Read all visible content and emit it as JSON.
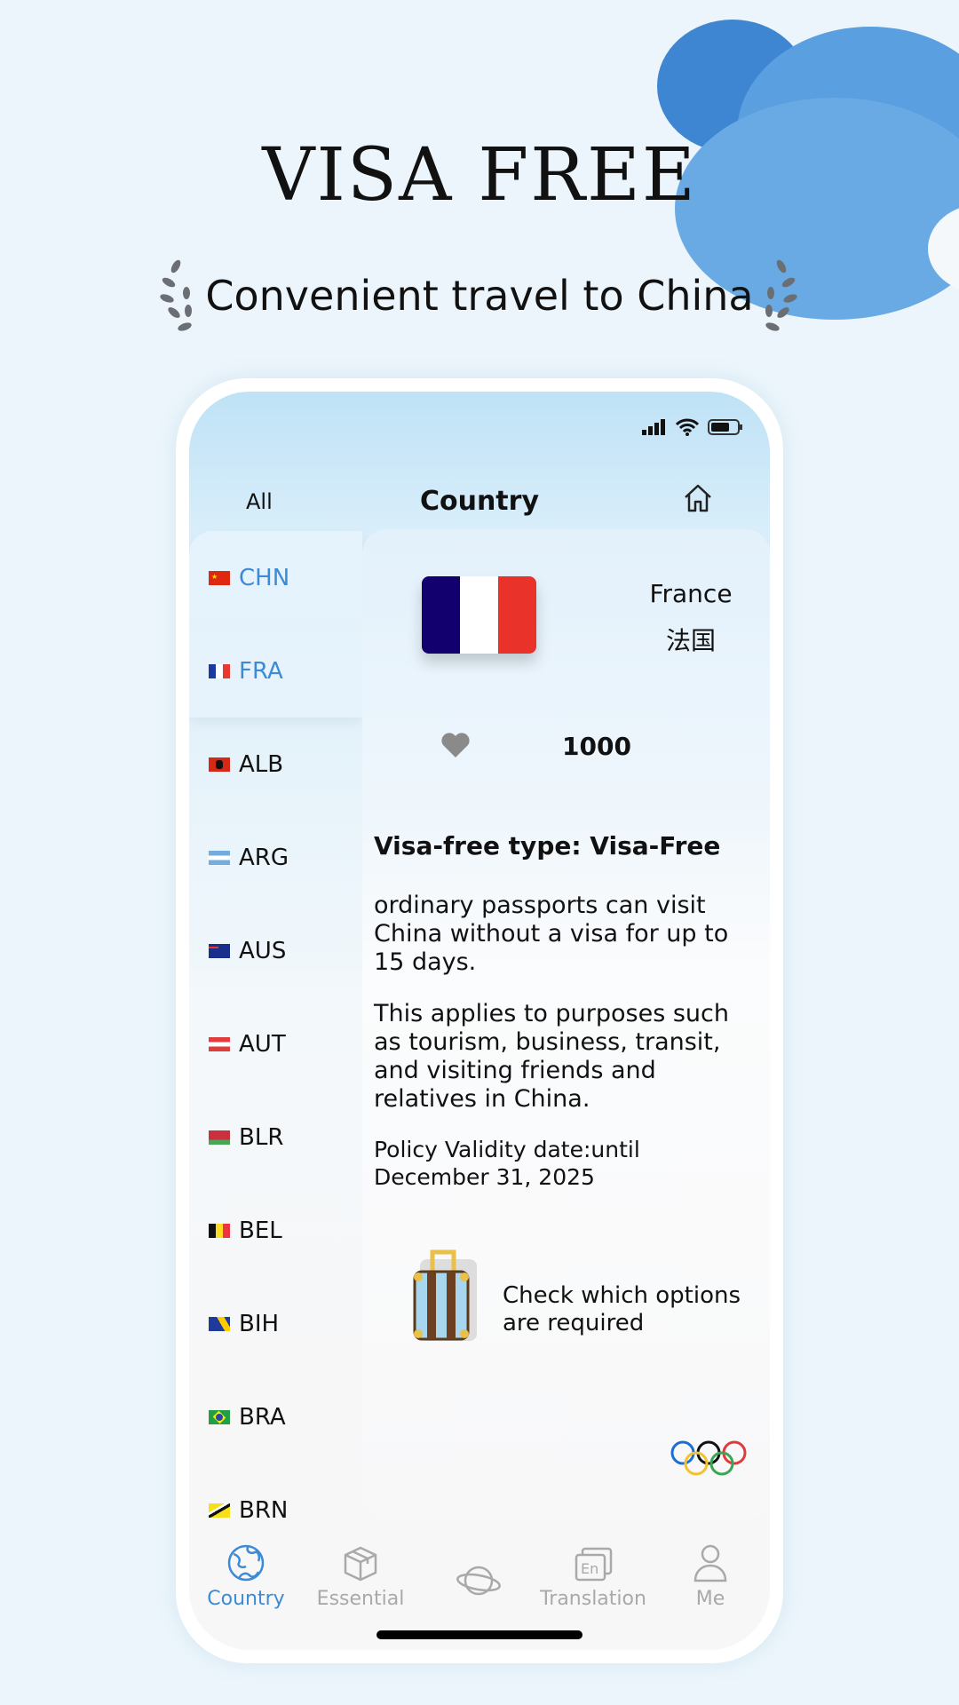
{
  "promo": {
    "title": "VISA FREE",
    "subtitle": "Convenient travel to China"
  },
  "header": {
    "left_label": "All",
    "title": "Country",
    "home_icon": "home-icon"
  },
  "countries": [
    {
      "code": "CHN",
      "selected": true
    },
    {
      "code": "FRA",
      "selected": true
    },
    {
      "code": "ALB"
    },
    {
      "code": "ARG"
    },
    {
      "code": "AUS"
    },
    {
      "code": "AUT"
    },
    {
      "code": "BLR"
    },
    {
      "code": "BEL"
    },
    {
      "code": "BIH"
    },
    {
      "code": "BRA"
    },
    {
      "code": "BRN"
    }
  ],
  "detail": {
    "name_en": "France",
    "name_zh": "法国",
    "likes": "1000",
    "visa_type": "Visa-free type: Visa-Free",
    "paragraph1": "ordinary passports can visit China without a visa for up to 15 days.",
    "paragraph2": "This applies to purposes such as tourism, business, transit, and visiting friends and relatives in China.",
    "policy": "Policy Validity date:until December 31, 2025",
    "check_options": "Check which options are required"
  },
  "tabs": [
    {
      "label": "Country",
      "icon": "globe-icon",
      "active": true
    },
    {
      "label": "Essential",
      "icon": "box-icon"
    },
    {
      "label": "",
      "icon": "planet-icon"
    },
    {
      "label": "Translation",
      "icon": "translate-icon"
    },
    {
      "label": "Me",
      "icon": "user-icon"
    }
  ],
  "colors": {
    "accent": "#3d8ad6",
    "background": "#ebf5fb",
    "cloud": "#4a8fd6"
  }
}
